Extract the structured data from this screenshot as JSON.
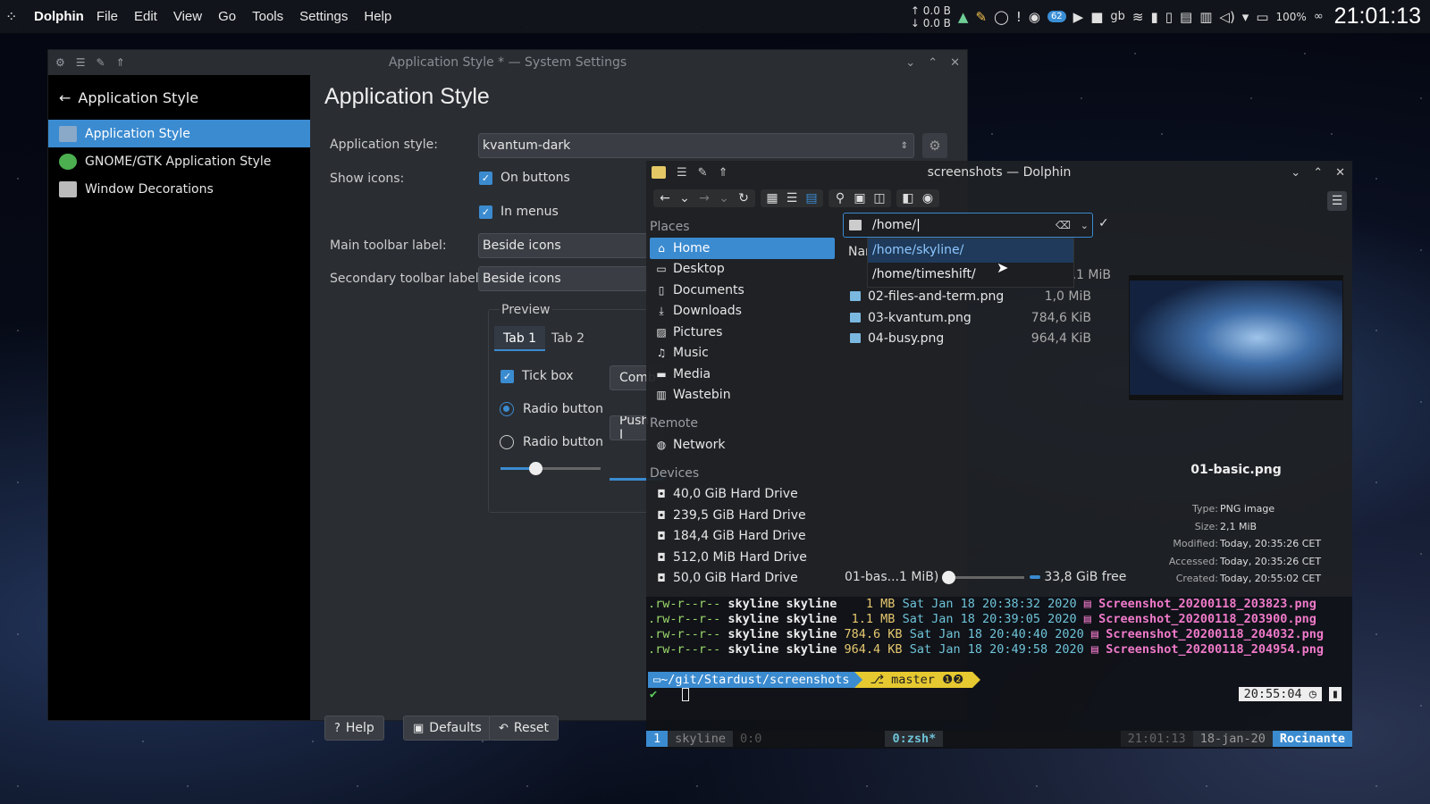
{
  "panel": {
    "app_name": "Dolphin",
    "menu": [
      "File",
      "Edit",
      "View",
      "Go",
      "Tools",
      "Settings",
      "Help"
    ],
    "net_up": "↑ 0.0 B",
    "net_down": "↓ 0.0 B",
    "notifications_badge": "62",
    "keyboard_layout": "gb",
    "battery_percent": "100%",
    "clock": "21:01:13"
  },
  "settings_window": {
    "title": "Application Style * — System Settings",
    "sidebar": {
      "back_label": "Application Style",
      "items": [
        {
          "label": "Application Style",
          "active": true
        },
        {
          "label": "GNOME/GTK Application Style",
          "active": false
        },
        {
          "label": "Window Decorations",
          "active": false
        }
      ]
    },
    "heading": "Application Style",
    "app_style_label": "Application style:",
    "app_style_value": "kvantum-dark",
    "show_icons_label": "Show icons:",
    "on_buttons": "On buttons",
    "in_menus": "In menus",
    "main_toolbar_label": "Main toolbar label:",
    "main_toolbar_value": "Beside icons",
    "secondary_toolbar_label": "Secondary toolbar label:",
    "secondary_toolbar_value": "Beside icons",
    "preview": {
      "title": "Preview",
      "tab1": "Tab 1",
      "tab2": "Tab 2",
      "tick_box": "Tick box",
      "radio1": "Radio button",
      "radio2": "Radio button",
      "combo_partial": "Comb",
      "push_partial": "Push I",
      "slider_value": 0.35
    },
    "buttons": {
      "help": "Help",
      "defaults": "Defaults",
      "reset": "Reset"
    }
  },
  "dolphin": {
    "title": "screenshots — Dolphin",
    "places_header": "Places",
    "places": [
      "Home",
      "Desktop",
      "Documents",
      "Downloads",
      "Pictures",
      "Music",
      "Media",
      "Wastebin"
    ],
    "remote_header": "Remote",
    "remote": [
      "Network"
    ],
    "devices_header": "Devices",
    "devices": [
      "40,0 GiB Hard Drive",
      "239,5 GiB Hard Drive",
      "184,4 GiB Hard Drive",
      "512,0 MiB Hard Drive",
      "50,0 GiB Hard Drive"
    ],
    "url": "/home/",
    "completions": [
      "/home/skyline/",
      "/home/timeshift/"
    ],
    "column_header_partial": "Nar",
    "files": [
      {
        "name": "",
        "size": ",1 MiB"
      },
      {
        "name": "02-files-and-term.png",
        "size": "1,0 MiB"
      },
      {
        "name": "03-kvantum.png",
        "size": "784,6 KiB"
      },
      {
        "name": "04-busy.png",
        "size": "964,4 KiB"
      }
    ],
    "info_panel": {
      "filename": "01-basic.png",
      "keys": [
        "Type:",
        "Size:",
        "Modified:",
        "Accessed:",
        "Created:"
      ],
      "values": [
        "PNG image",
        "2,1 MiB",
        "Today, 20:35:26 CET",
        "Today, 20:35:26 CET",
        "Today, 20:55:02 CET"
      ]
    },
    "status_text": "01-bas...1 MiB)",
    "free_space": "33,8 GiB free"
  },
  "terminal": {
    "rows": [
      {
        "perm": ".rw-r--r--",
        "user": "skyline",
        "group": "skyline",
        "size": "   1 MB",
        "date": "Sat Jan 18 20:38:32 2020",
        "file": "Screenshot_20200118_203823.png"
      },
      {
        "perm": ".rw-r--r--",
        "user": "skyline",
        "group": "skyline",
        "size": " 1.1 MB",
        "date": "Sat Jan 18 20:39:05 2020",
        "file": "Screenshot_20200118_203900.png"
      },
      {
        "perm": ".rw-r--r--",
        "user": "skyline",
        "group": "skyline",
        "size": "784.6 KB",
        "date": "Sat Jan 18 20:40:40 2020",
        "file": "Screenshot_20200118_204032.png"
      },
      {
        "perm": ".rw-r--r--",
        "user": "skyline",
        "group": "skyline",
        "size": "964.4 KB",
        "date": "Sat Jan 18 20:49:58 2020",
        "file": "Screenshot_20200118_204954.png"
      }
    ],
    "prompt_dir": "~/git/Stardust/screenshots",
    "prompt_branch": "master",
    "right_time": "20:55:04",
    "tmux": {
      "window_index": "1",
      "session": "skyline",
      "pane": "0:0",
      "active_window": "0:zsh*",
      "time": "21:01:13",
      "date": "18-jan-20",
      "host": "Rocinante"
    }
  },
  "colors": {
    "accent": "#3b8bd0",
    "git_yellow": "#e6c830"
  }
}
